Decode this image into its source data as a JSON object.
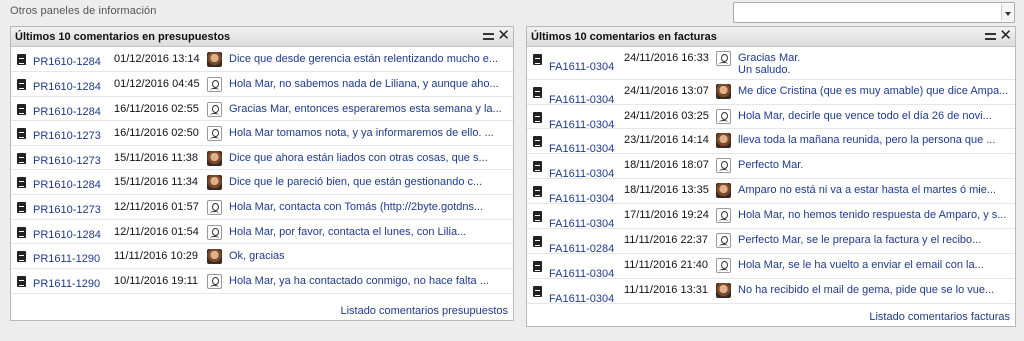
{
  "section_title": "Otros paneles de información",
  "panel_select": {
    "value": ""
  },
  "left_panel": {
    "title": "Últimos 10 comentarios en presupuestos",
    "footer_link": "Listado comentarios presupuestos",
    "rows": [
      {
        "ref": "PR1610-1284",
        "date": "01/12/2016 13:14",
        "avatar": "photo",
        "comment": "Dice que desde gerencia están relentizando mucho e..."
      },
      {
        "ref": "PR1610-1284",
        "date": "01/12/2016 04:45",
        "avatar": "sketch",
        "comment": "Hola Mar, no sabemos nada de Liliana, y aunque aho..."
      },
      {
        "ref": "PR1610-1284",
        "date": "16/11/2016 02:55",
        "avatar": "sketch",
        "comment": "Gracias Mar, entonces esperaremos esta semana y la..."
      },
      {
        "ref": "PR1610-1273",
        "date": "16/11/2016 02:50",
        "avatar": "sketch",
        "comment": "Hola Mar tomamos nota, y ya informaremos de ello. ..."
      },
      {
        "ref": "PR1610-1273",
        "date": "15/11/2016 11:38",
        "avatar": "photo",
        "comment": "Dice que ahora están liados con otras cosas, que s..."
      },
      {
        "ref": "PR1610-1284",
        "date": "15/11/2016 11:34",
        "avatar": "photo",
        "comment": "Dice que le pareció  bien, que están gestionando c..."
      },
      {
        "ref": "PR1610-1273",
        "date": "12/11/2016 01:57",
        "avatar": "sketch",
        "comment": "Hola Mar,  contacta con Tomás (http://2byte.gotdns..."
      },
      {
        "ref": "PR1610-1284",
        "date": "12/11/2016 01:54",
        "avatar": "sketch",
        "comment": "Hola Mar,  por favor, contacta el lunes, con Lilia..."
      },
      {
        "ref": "PR1611-1290",
        "date": "11/11/2016 10:29",
        "avatar": "photo",
        "comment": "Ok, gracias"
      },
      {
        "ref": "PR1611-1290",
        "date": "10/11/2016 19:11",
        "avatar": "sketch",
        "comment": "Hola Mar, ya ha contactado conmigo, no hace falta ..."
      }
    ]
  },
  "right_panel": {
    "title": "Últimos 10 comentarios en facturas",
    "footer_link": "Listado comentarios facturas",
    "rows": [
      {
        "ref": "FA1611-0304",
        "date": "24/11/2016 16:33",
        "avatar": "sketch",
        "comment": "Gracias Mar.\nUn saludo."
      },
      {
        "ref": "FA1611-0304",
        "date": "24/11/2016 13:07",
        "avatar": "photo",
        "comment": "Me dice Cristina (que es muy amable) que dice Ampa..."
      },
      {
        "ref": "FA1611-0304",
        "date": "24/11/2016 03:25",
        "avatar": "sketch",
        "comment": "Hola Mar, decirle que vence todo el día 26 de novi..."
      },
      {
        "ref": "FA1611-0304",
        "date": "23/11/2016 14:14",
        "avatar": "photo",
        "comment": "lleva toda la mañana reunida, pero la persona que ..."
      },
      {
        "ref": "FA1611-0304",
        "date": "18/11/2016 18:07",
        "avatar": "sketch",
        "comment": "Perfecto Mar."
      },
      {
        "ref": "FA1611-0304",
        "date": "18/11/2016 13:35",
        "avatar": "photo",
        "comment": "Amparo no está ni va a estar hasta el martes ó mie..."
      },
      {
        "ref": "FA1611-0304",
        "date": "17/11/2016 19:24",
        "avatar": "sketch",
        "comment": "Hola Mar, no hemos tenido respuesta de Amparo, y s..."
      },
      {
        "ref": "FA1611-0284",
        "date": "11/11/2016 22:37",
        "avatar": "sketch",
        "comment": "Perfecto Mar, se le prepara la factura y el recibo..."
      },
      {
        "ref": "FA1611-0304",
        "date": "11/11/2016 21:40",
        "avatar": "sketch",
        "comment": "Hola Mar, se le ha vuelto a enviar el email con la..."
      },
      {
        "ref": "FA1611-0304",
        "date": "11/11/2016 13:31",
        "avatar": "photo",
        "comment": "No ha recibido el mail de gema, pide que se lo vue..."
      }
    ]
  }
}
